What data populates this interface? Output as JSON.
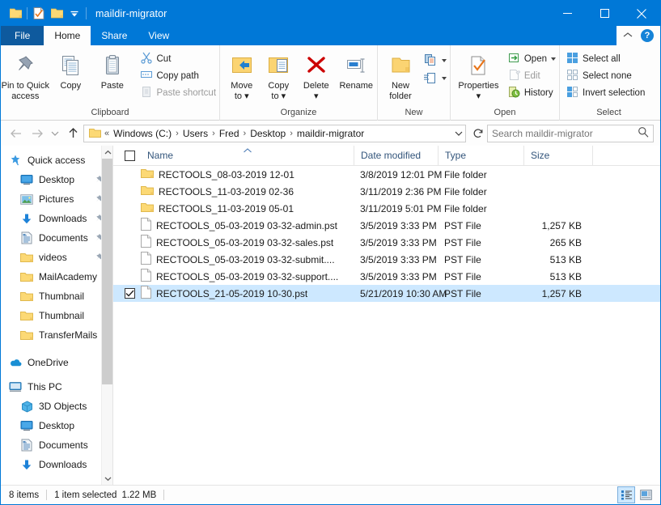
{
  "window": {
    "title": "maildir-migrator",
    "quick_access_icons": [
      "folder-icon",
      "properties-icon",
      "new-folder-icon",
      "customize-qat-icon"
    ],
    "controls": {
      "minimize": "minimize-icon",
      "maximize": "maximize-icon",
      "close": "close-icon"
    }
  },
  "tabs": [
    {
      "label": "File",
      "active": false,
      "kind": "file"
    },
    {
      "label": "Home",
      "active": true,
      "kind": "normal"
    },
    {
      "label": "Share",
      "active": false,
      "kind": "normal"
    },
    {
      "label": "View",
      "active": false,
      "kind": "normal"
    }
  ],
  "tab_right": {
    "collapse": "chevron-up-icon",
    "help": "?"
  },
  "ribbon": {
    "groups": [
      {
        "label": "Clipboard",
        "big": [
          {
            "label": "Pin to Quick\naccess",
            "line1": "Pin to Quick",
            "line2": "access",
            "icon": "pin-icon",
            "disabled": false
          },
          {
            "label": "Copy",
            "line1": "Copy",
            "line2": "",
            "icon": "copy-icon",
            "disabled": false
          },
          {
            "label": "Paste",
            "line1": "Paste",
            "line2": "",
            "icon": "paste-icon",
            "disabled": false
          }
        ],
        "small": [
          {
            "label": "Cut",
            "icon": "scissors-icon",
            "disabled": false
          },
          {
            "label": "Copy path",
            "icon": "copy-path-icon",
            "disabled": false
          },
          {
            "label": "Paste shortcut",
            "icon": "paste-shortcut-icon",
            "disabled": true
          }
        ]
      },
      {
        "label": "Organize",
        "big": [
          {
            "line1": "Move",
            "line2": "to",
            "icon": "move-to-icon",
            "dropdown": true
          },
          {
            "line1": "Copy",
            "line2": "to",
            "icon": "copy-to-icon",
            "dropdown": true
          },
          {
            "line1": "Delete",
            "line2": "",
            "icon": "delete-icon",
            "dropdown": true
          },
          {
            "line1": "Rename",
            "line2": "",
            "icon": "rename-icon",
            "dropdown": false
          }
        ],
        "small": []
      },
      {
        "label": "New",
        "big": [
          {
            "line1": "New",
            "line2": "folder",
            "icon": "new-folder-icon",
            "dropdown": false
          }
        ],
        "small": [
          {
            "label": "",
            "icon": "new-item-icon",
            "dropdown": true
          },
          {
            "label": "",
            "icon": "easy-access-icon",
            "dropdown": true
          }
        ]
      },
      {
        "label": "Open",
        "big": [
          {
            "line1": "Properties",
            "line2": "",
            "icon": "properties-icon",
            "dropdown": true
          }
        ],
        "small": [
          {
            "label": "Open",
            "icon": "open-icon",
            "dropdown": true,
            "disabled": false
          },
          {
            "label": "Edit",
            "icon": "edit-icon",
            "dropdown": false,
            "disabled": true
          },
          {
            "label": "History",
            "icon": "history-icon",
            "dropdown": false,
            "disabled": false
          }
        ]
      },
      {
        "label": "Select",
        "big": [],
        "small": [
          {
            "label": "Select all",
            "icon": "select-all-icon",
            "disabled": false
          },
          {
            "label": "Select none",
            "icon": "select-none-icon",
            "disabled": false
          },
          {
            "label": "Invert selection",
            "icon": "invert-selection-icon",
            "disabled": false
          }
        ]
      }
    ]
  },
  "addressbar": {
    "back": "back-arrow-icon",
    "forward": "forward-arrow-icon",
    "recent": "chevron-down-icon",
    "up": "up-arrow-icon",
    "folder_icon": "folder-icon",
    "overflow": "«",
    "crumbs": [
      "Windows (C:)",
      "Users",
      "Fred",
      "Desktop",
      "maildir-migrator"
    ],
    "dropdown": "chevron-down-icon",
    "refresh": "refresh-icon",
    "search_placeholder": "Search maildir-migrator",
    "search_value": "",
    "search_icon": "search-icon"
  },
  "navpane": {
    "items": [
      {
        "label": "Quick access",
        "icon": "star-pin-icon",
        "indent": 0,
        "pinned": false
      },
      {
        "label": "Desktop",
        "icon": "desktop-icon",
        "indent": 1,
        "pinned": true
      },
      {
        "label": "Pictures",
        "icon": "pictures-icon",
        "indent": 1,
        "pinned": true
      },
      {
        "label": "Downloads",
        "icon": "downloads-icon",
        "indent": 1,
        "pinned": true
      },
      {
        "label": "Documents",
        "icon": "documents-icon",
        "indent": 1,
        "pinned": true
      },
      {
        "label": "videos",
        "icon": "folder-icon",
        "indent": 1,
        "pinned": true
      },
      {
        "label": "MailAcademy",
        "icon": "folder-icon",
        "indent": 1,
        "pinned": false
      },
      {
        "label": "Thumbnail",
        "icon": "folder-icon",
        "indent": 1,
        "pinned": false
      },
      {
        "label": "Thumbnail",
        "icon": "folder-icon",
        "indent": 1,
        "pinned": false
      },
      {
        "label": "TransferMails",
        "icon": "folder-icon",
        "indent": 1,
        "pinned": false
      },
      {
        "label": "OneDrive",
        "icon": "onedrive-icon",
        "indent": 0,
        "pinned": false
      },
      {
        "label": "This PC",
        "icon": "this-pc-icon",
        "indent": 0,
        "pinned": false
      },
      {
        "label": "3D Objects",
        "icon": "3d-objects-icon",
        "indent": 1,
        "pinned": false
      },
      {
        "label": "Desktop",
        "icon": "desktop-icon",
        "indent": 1,
        "pinned": false
      },
      {
        "label": "Documents",
        "icon": "documents-icon",
        "indent": 1,
        "pinned": false
      },
      {
        "label": "Downloads",
        "icon": "downloads-icon",
        "indent": 1,
        "pinned": false
      }
    ],
    "scroll_up": "scroll-up-arrow",
    "scroll_down": "scroll-down-arrow"
  },
  "filelist": {
    "columns": [
      {
        "label": "Name",
        "sorted": true
      },
      {
        "label": "Date modified",
        "sorted": false
      },
      {
        "label": "Type",
        "sorted": false
      },
      {
        "label": "Size",
        "sorted": false
      }
    ],
    "rows": [
      {
        "name": "RECTOOLS_08-03-2019 12-01",
        "date": "3/8/2019 12:01 PM",
        "type": "File folder",
        "size": "",
        "icon": "folder-icon",
        "selected": false,
        "checked": false
      },
      {
        "name": "RECTOOLS_11-03-2019 02-36",
        "date": "3/11/2019 2:36 PM",
        "type": "File folder",
        "size": "",
        "icon": "folder-icon",
        "selected": false,
        "checked": false
      },
      {
        "name": "RECTOOLS_11-03-2019 05-01",
        "date": "3/11/2019 5:01 PM",
        "type": "File folder",
        "size": "",
        "icon": "folder-icon",
        "selected": false,
        "checked": false
      },
      {
        "name": "RECTOOLS_05-03-2019 03-32-admin.pst",
        "date": "3/5/2019 3:33 PM",
        "type": "PST File",
        "size": "1,257 KB",
        "icon": "file-icon",
        "selected": false,
        "checked": false
      },
      {
        "name": "RECTOOLS_05-03-2019 03-32-sales.pst",
        "date": "3/5/2019 3:33 PM",
        "type": "PST File",
        "size": "265 KB",
        "icon": "file-icon",
        "selected": false,
        "checked": false
      },
      {
        "name": "RECTOOLS_05-03-2019 03-32-submit....",
        "date": "3/5/2019 3:33 PM",
        "type": "PST File",
        "size": "513 KB",
        "icon": "file-icon",
        "selected": false,
        "checked": false
      },
      {
        "name": "RECTOOLS_05-03-2019 03-32-support....",
        "date": "3/5/2019 3:33 PM",
        "type": "PST File",
        "size": "513 KB",
        "icon": "file-icon",
        "selected": false,
        "checked": false
      },
      {
        "name": "RECTOOLS_21-05-2019 10-30.pst",
        "date": "5/21/2019 10:30 AM",
        "type": "PST File",
        "size": "1,257 KB",
        "icon": "file-icon",
        "selected": true,
        "checked": true
      }
    ]
  },
  "statusbar": {
    "item_count": "8 items",
    "selection": "1 item selected",
    "selection_size": "1.22 MB",
    "view_buttons": [
      {
        "name": "details-view-button",
        "active": true
      },
      {
        "name": "large-icons-view-button",
        "active": false
      }
    ]
  },
  "colors": {
    "accent": "#0078d7",
    "selection": "#cde8ff",
    "folder": "#fbd472",
    "column_header_text": "#33557b"
  }
}
